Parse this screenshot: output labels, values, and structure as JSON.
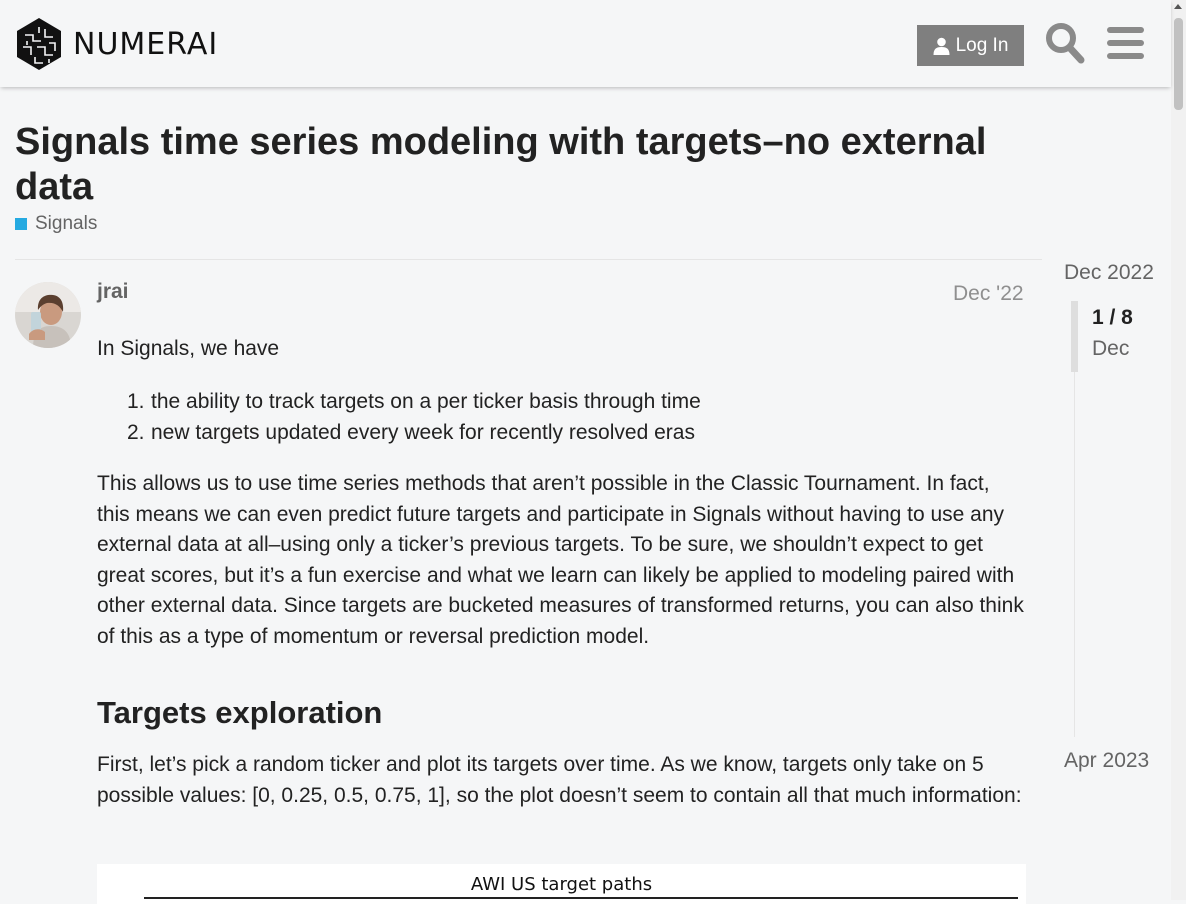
{
  "header": {
    "logo_text": "NUMERAI",
    "login_label": "Log In"
  },
  "topic": {
    "title": "Signals time series modeling with targets–no external data",
    "category": "Signals",
    "category_color": "#25aae1"
  },
  "post": {
    "username": "jrai",
    "date": "Dec '22",
    "intro": "In Signals, we have",
    "list": [
      {
        "num": "1.",
        "text": "the ability to track targets on a per ticker basis through time"
      },
      {
        "num": "2.",
        "text": "new targets updated every week for recently resolved eras"
      }
    ],
    "paragraph": "This allows us to use time series methods that aren’t possible in the Classic Tournament. In fact, this means we can even predict future targets and participate in Signals without having to use any external data at all–using only a ticker’s previous targets. To be sure, we shouldn’t expect to get great scores, but it’s a fun exercise and what we learn can likely be applied to modeling paired with other external data. Since targets are bucketed measures of transformed returns, you can also think of this as a type of momentum or reversal prediction model.",
    "heading": "Targets exploration",
    "paragraph2": "First, let’s pick a random ticker and plot its targets over time. As we know, targets only take on 5 possible values: [0, 0.25, 0.5, 0.75, 1], so the plot doesn’t seem to contain all that much information:",
    "image_title": "AWI US target paths"
  },
  "timeline": {
    "start": "Dec 2022",
    "position": "1 / 8",
    "current_date": "Dec",
    "end": "Apr 2023"
  }
}
